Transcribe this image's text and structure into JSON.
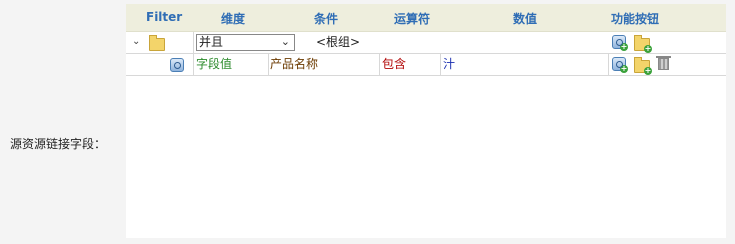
{
  "side_label": "源资源链接字段：",
  "header": {
    "filter": "Filter",
    "dimension": "维度",
    "condition": "条件",
    "operator": "运算符",
    "value": "数值",
    "actions": "功能按钮"
  },
  "group_row": {
    "logic_select_value": "并且",
    "root_label": "<根组>"
  },
  "condition_row": {
    "field_label": "字段值",
    "dimension_value": "产品名称",
    "operator_value": "包含",
    "value": "汁"
  },
  "colors": {
    "header_bg": "#eeeedd",
    "header_text": "#2f6db5"
  }
}
